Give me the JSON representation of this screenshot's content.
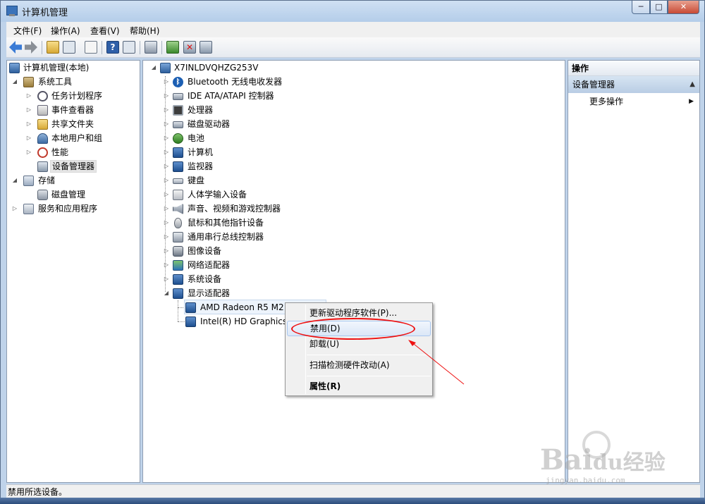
{
  "window": {
    "title": "计算机管理",
    "controls": {
      "minimize": "─",
      "maximize": "□",
      "close": "✕"
    }
  },
  "menu": [
    "文件(F)",
    "操作(A)",
    "查看(V)",
    "帮助(H)"
  ],
  "toolbar_icons": [
    "back-icon",
    "forward-icon",
    "up-folder-icon",
    "show-hide-tree-icon",
    "properties-icon",
    "help-icon",
    "show-hide-action-icon",
    "scan-hardware-icon",
    "update-driver-icon",
    "uninstall-icon",
    "disable-icon"
  ],
  "left_tree": {
    "root": "计算机管理(本地)",
    "system_tools": "系统工具",
    "task_scheduler": "任务计划程序",
    "event_viewer": "事件查看器",
    "shared_folders": "共享文件夹",
    "local_users": "本地用户和组",
    "performance": "性能",
    "device_manager": "设备管理器",
    "storage": "存储",
    "disk_management": "磁盘管理",
    "services_apps": "服务和应用程序"
  },
  "device_tree": {
    "computer_name": "X7INLDVQHZG253V",
    "categories": {
      "bluetooth": "Bluetooth 无线电收发器",
      "ide": "IDE ATA/ATAPI 控制器",
      "processor": "处理器",
      "disk_drives": "磁盘驱动器",
      "battery": "电池",
      "computer": "计算机",
      "monitor": "监视器",
      "keyboard": "键盘",
      "hid": "人体学输入设备",
      "sound": "声音、视频和游戏控制器",
      "mouse": "鼠标和其他指针设备",
      "usb": "通用串行总线控制器",
      "imaging": "图像设备",
      "network": "网络适配器",
      "system": "系统设备",
      "display": "显示适配器"
    },
    "display_children": {
      "amd": "AMD Radeon R5 M2",
      "intel": "Intel(R) HD Graphics"
    }
  },
  "context_menu": {
    "update_driver": "更新驱动程序软件(P)...",
    "disable": "禁用(D)",
    "uninstall": "卸载(U)",
    "scan": "扫描检测硬件改动(A)",
    "properties": "属性(R)"
  },
  "actions_pane": {
    "header": "操作",
    "section": "设备管理器",
    "more_actions": "更多操作"
  },
  "status_bar": "禁用所选设备。",
  "watermark": {
    "brand": "Bai",
    "brand_tail": "du",
    "cn": "经验",
    "url": "jingyan.baidu.com"
  },
  "colors": {
    "annotation": "#ee1111",
    "titlebar": "#b4cde9",
    "highlight": "#dbe7f7"
  }
}
